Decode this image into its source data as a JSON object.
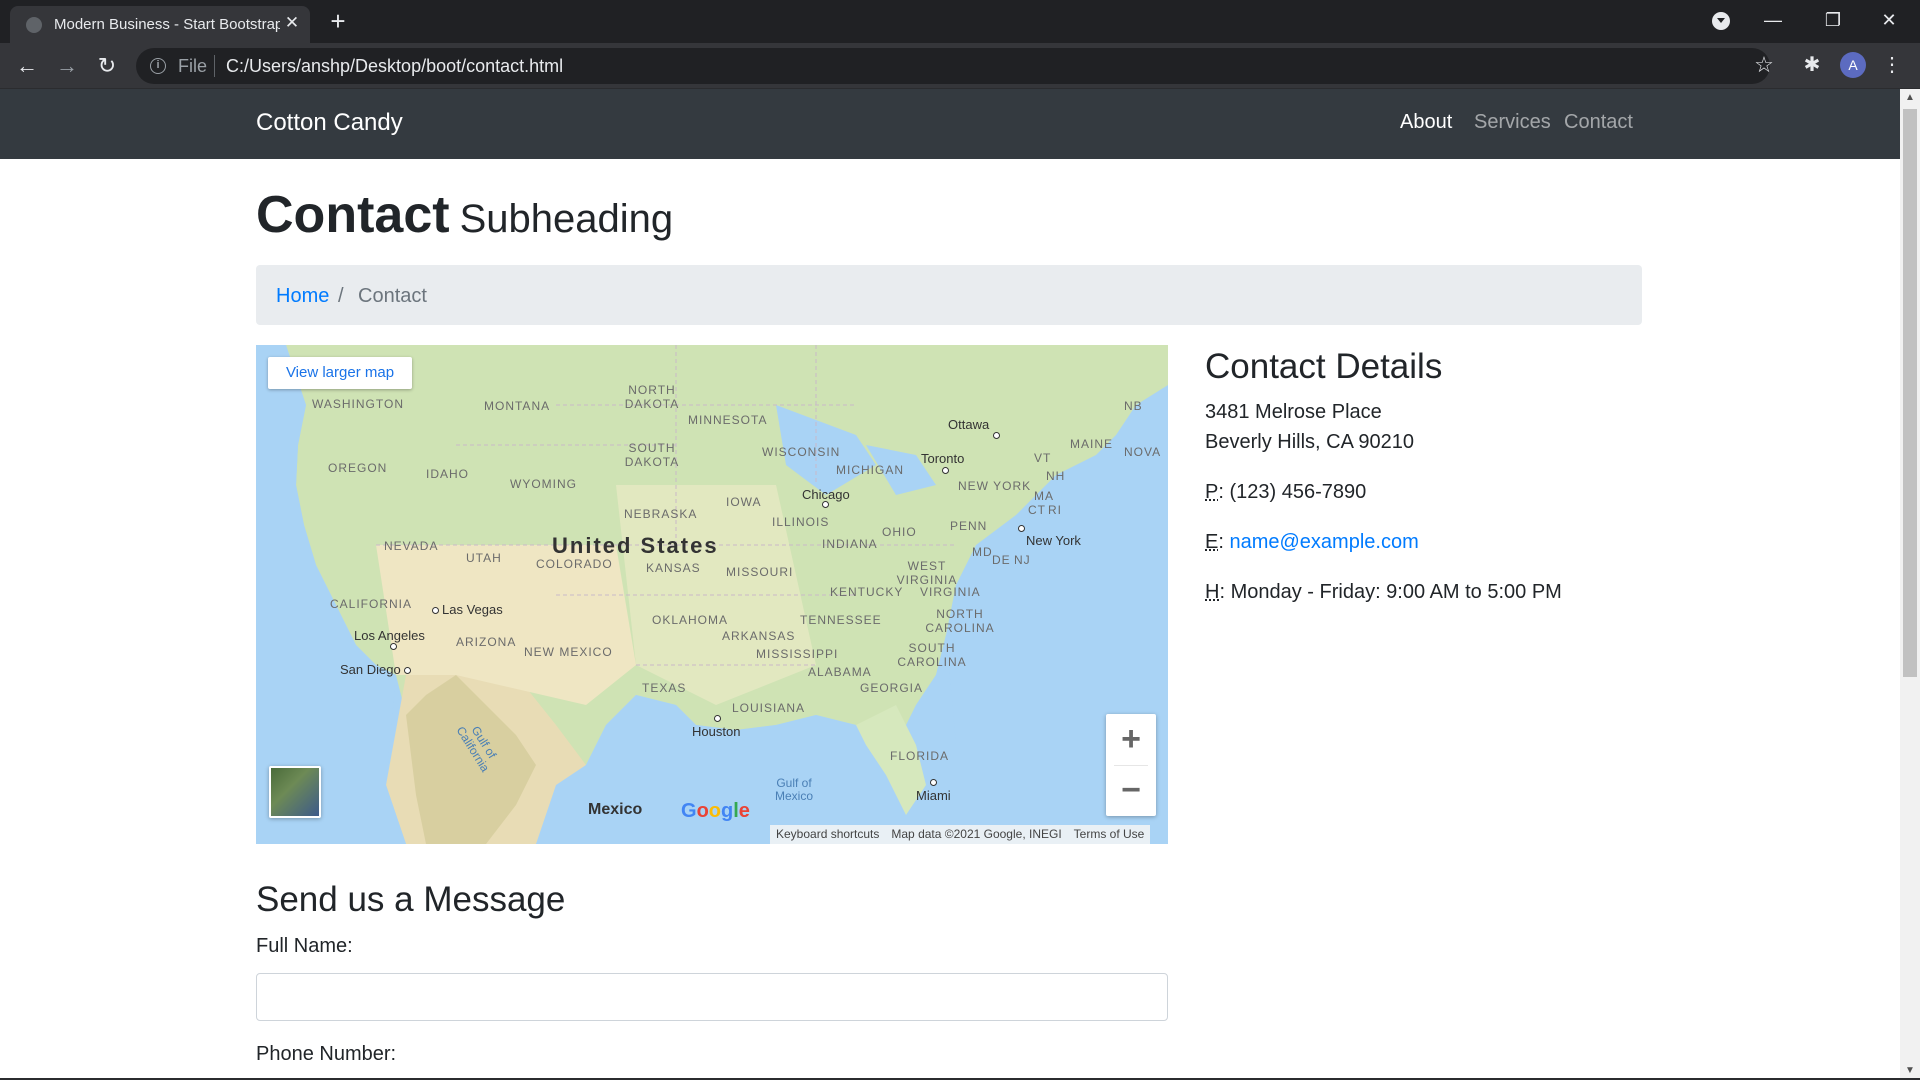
{
  "browser": {
    "tab_title": "Modern Business - Start Bootstrap",
    "tab_close": "✕",
    "new_tab": "+",
    "omnibox_scheme": "File",
    "url": "C:/Users/anshp/Desktop/boot/contact.html",
    "avatar_letter": "A",
    "window_controls": {
      "minimize": "—",
      "restore": "❐",
      "close": "✕"
    }
  },
  "navbar": {
    "brand": "Cotton Candy",
    "links": [
      {
        "label": "About",
        "active": true
      },
      {
        "label": "Services",
        "active": false
      },
      {
        "label": "Contact",
        "active": false
      }
    ]
  },
  "heading": {
    "title": "Contact",
    "subtitle": "Subheading"
  },
  "breadcrumb": {
    "home": "Home",
    "separator": "/",
    "current": "Contact"
  },
  "map": {
    "view_larger": "View larger map",
    "country": "United States",
    "mexico": "Mexico",
    "states": [
      "WASHINGTON",
      "MONTANA",
      "NORTH DAKOTA",
      "MINNESOTA",
      "OREGON",
      "IDAHO",
      "SOUTH DAKOTA",
      "WYOMING",
      "WISCONSIN",
      "MICHIGAN",
      "NEBRASKA",
      "IOWA",
      "NEVADA",
      "UTAH",
      "COLORADO",
      "KANSAS",
      "ILLINOIS",
      "INDIANA",
      "OHIO",
      "PENN",
      "CALIFORNIA",
      "MISSOURI",
      "KENTUCKY",
      "WEST VIRGINIA",
      "VIRGINIA",
      "ARIZONA",
      "NEW MEXICO",
      "OKLAHOMA",
      "ARKANSAS",
      "TENNESSEE",
      "NORTH CAROLINA",
      "SOUTH CAROLINA",
      "MISSISSIPPI",
      "ALABAMA",
      "GEORGIA",
      "TEXAS",
      "LOUISIANA",
      "FLORIDA",
      "NEW YORK",
      "MAINE",
      "VT",
      "NH",
      "MA",
      "CT",
      "RI",
      "MD",
      "DE",
      "NJ",
      "NB",
      "NOVA"
    ],
    "cities": [
      "Ottawa",
      "Toronto",
      "Chicago",
      "New York",
      "Las Vegas",
      "Los Angeles",
      "San Diego",
      "Houston",
      "Miami"
    ],
    "water": [
      "Gulf of California",
      "Gulf of Mexico"
    ],
    "zoom_in": "+",
    "zoom_out": "−",
    "google": "Google",
    "attribution": {
      "shortcuts": "Keyboard shortcuts",
      "data": "Map data ©2021 Google, INEGI",
      "terms": "Terms of Use"
    }
  },
  "details": {
    "title": "Contact Details",
    "address_line1": "3481 Melrose Place",
    "address_line2": "Beverly Hills, CA 90210",
    "phone_abbr": "P",
    "phone": "(123) 456-7890",
    "email_abbr": "E",
    "email": "name@example.com",
    "hours_abbr": "H",
    "hours": "Monday - Friday: 9:00 AM to 5:00 PM"
  },
  "form": {
    "title": "Send us a Message",
    "name_label": "Full Name:",
    "name_value": "",
    "phone_label": "Phone Number:"
  },
  "colors": {
    "navbar": "#343a40",
    "link": "#007bff",
    "breadcrumb_bg": "#e9ecef",
    "chrome_dark": "#202124"
  }
}
